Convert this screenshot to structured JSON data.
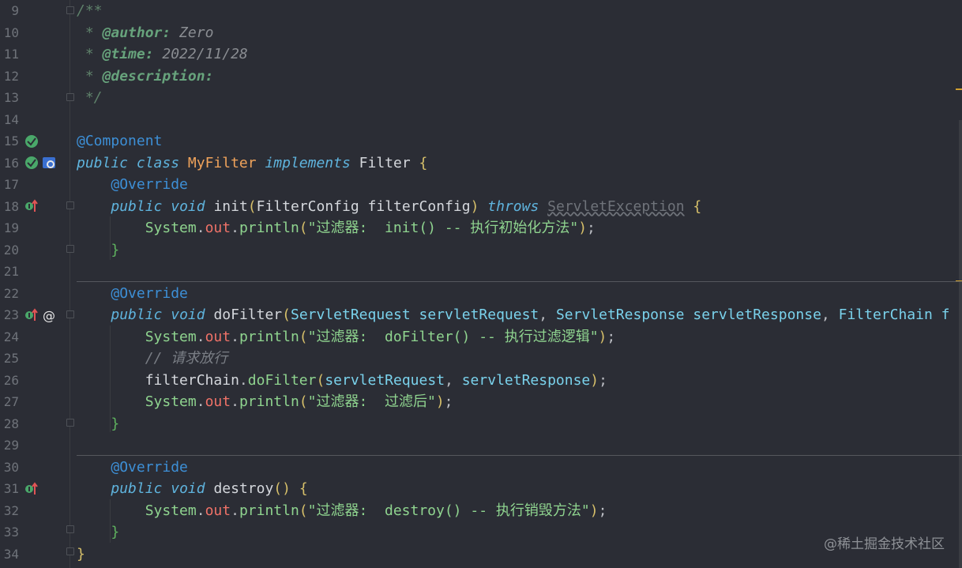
{
  "editor": {
    "lines": [
      {
        "num": "9",
        "code": "/**"
      },
      {
        "num": "10",
        "code": " * @author: Zero"
      },
      {
        "num": "11",
        "code": " * @time: 2022/11/28"
      },
      {
        "num": "12",
        "code": " * @description:"
      },
      {
        "num": "13",
        "code": " */"
      },
      {
        "num": "14",
        "code": ""
      },
      {
        "num": "15",
        "code": "@Component"
      },
      {
        "num": "16",
        "code": "public class MyFilter implements Filter {"
      },
      {
        "num": "17",
        "code": "    @Override"
      },
      {
        "num": "18",
        "code": "    public void init(FilterConfig filterConfig) throws ServletException {"
      },
      {
        "num": "19",
        "code": "        System.out.println(\"过滤器:  init() -- 执行初始化方法\");"
      },
      {
        "num": "20",
        "code": "    }"
      },
      {
        "num": "21",
        "code": ""
      },
      {
        "num": "22",
        "code": "    @Override"
      },
      {
        "num": "23",
        "code": "    public void doFilter(ServletRequest servletRequest, ServletResponse servletResponse, FilterChain f"
      },
      {
        "num": "24",
        "code": "        System.out.println(\"过滤器:  doFilter() -- 执行过滤逻辑\");"
      },
      {
        "num": "25",
        "code": "        // 请求放行"
      },
      {
        "num": "26",
        "code": "        filterChain.doFilter(servletRequest, servletResponse);"
      },
      {
        "num": "27",
        "code": "        System.out.println(\"过滤器:  过滤后\");"
      },
      {
        "num": "28",
        "code": "    }"
      },
      {
        "num": "29",
        "code": ""
      },
      {
        "num": "30",
        "code": "    @Override"
      },
      {
        "num": "31",
        "code": "    public void destroy() {"
      },
      {
        "num": "32",
        "code": "        System.out.println(\"过滤器:  destroy() -- 执行销毁方法\");"
      },
      {
        "num": "33",
        "code": "    }"
      },
      {
        "num": "34",
        "code": "}"
      }
    ]
  },
  "tokens": {
    "doc_open": "/**",
    "doc_star": " * ",
    "author_tag": "@author:",
    "author_val": " Zero",
    "time_tag": "@time:",
    "time_val": " 2022/11/28",
    "desc_tag": "@description:",
    "doc_close": " */",
    "component": "@Component",
    "public": "public",
    "class": "class",
    "class_name": "MyFilter",
    "implements": "implements",
    "filter": "Filter",
    "override": "@Override",
    "void": "void",
    "init": "init",
    "filter_config_type": "FilterConfig",
    "filter_config_param": "filterConfig",
    "throws": "throws",
    "servlet_exception": "ServletException",
    "system": "System",
    "out": "out",
    "println": "println",
    "str_init": "\"过滤器:  init() -- 执行初始化方法\"",
    "dofilter": "doFilter",
    "servlet_request_type": "ServletRequest",
    "servlet_request": "servletRequest",
    "servlet_response_type": "ServletResponse",
    "servlet_response": "servletResponse",
    "filter_chain_type": "FilterChain",
    "truncated": "f",
    "str_dofilter": "\"过滤器:  doFilter() -- 执行过滤逻辑\"",
    "comment": "// 请求放行",
    "filter_chain": "filterChain",
    "str_after": "\"过滤器:  过滤后\"",
    "destroy": "destroy",
    "str_destroy": "\"过滤器:  destroy() -- 执行销毁方法\""
  },
  "gutter_icons": {
    "line15": "spring-bean-icon",
    "line16": [
      "spring-bean-icon",
      "web-filter-icon"
    ],
    "line18": "implements-method-icon",
    "line23": [
      "implements-method-icon",
      "annotation-at-icon"
    ],
    "line31": "implements-method-icon"
  },
  "colors": {
    "background": "#2b2d35",
    "keyword": "#5fb4de",
    "annotation": "#3d8fd6",
    "string": "#8fd48f",
    "field": "#f07268",
    "class_name": "#f0a35b"
  },
  "watermark": "@稀土掘金技术社区"
}
